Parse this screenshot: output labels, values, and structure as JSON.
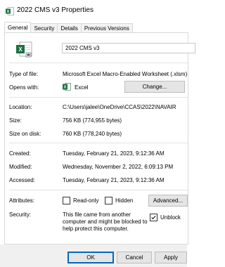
{
  "window": {
    "title": "2022 CMS v3 Properties"
  },
  "tabs": [
    {
      "label": "General",
      "active": true
    },
    {
      "label": "Security"
    },
    {
      "label": "Details"
    },
    {
      "label": "Previous Versions"
    }
  ],
  "general": {
    "file_name": "2022 CMS v3",
    "type_label": "Type of file:",
    "type_value": "Microsoft Excel Macro-Enabled Worksheet (.xlsm)",
    "opens_label": "Opens with:",
    "opens_value": "Excel",
    "change_button": "Change...",
    "location_label": "Location:",
    "location_value": "C:\\Users\\jalee\\OneDrive\\CCAS\\2022\\NAVAIR",
    "size_label": "Size:",
    "size_value": "756 KB (774,955 bytes)",
    "size_disk_label": "Size on disk:",
    "size_disk_value": "760 KB (778,240 bytes)",
    "created_label": "Created:",
    "created_value": "Tuesday, February 21, 2023, 9:12:36 AM",
    "modified_label": "Modified:",
    "modified_value": "Wednesday, November 2, 2022, 6:09:13 PM",
    "accessed_label": "Accessed:",
    "accessed_value": "Tuesday, February 21, 2023, 9:12:36 AM",
    "attributes_label": "Attributes:",
    "readonly_label": "Read-only",
    "hidden_label": "Hidden",
    "advanced_button": "Advanced...",
    "security_label": "Security:",
    "security_line1": "This file came from another",
    "security_line2": "computer and might be blocked to",
    "security_line3": "help protect this computer.",
    "unblock_label": "Unblock"
  },
  "footer": {
    "ok": "OK",
    "cancel": "Cancel",
    "apply": "Apply"
  },
  "colors": {
    "excel_green": "#1d6f42",
    "separator": "#e3e3e3"
  }
}
